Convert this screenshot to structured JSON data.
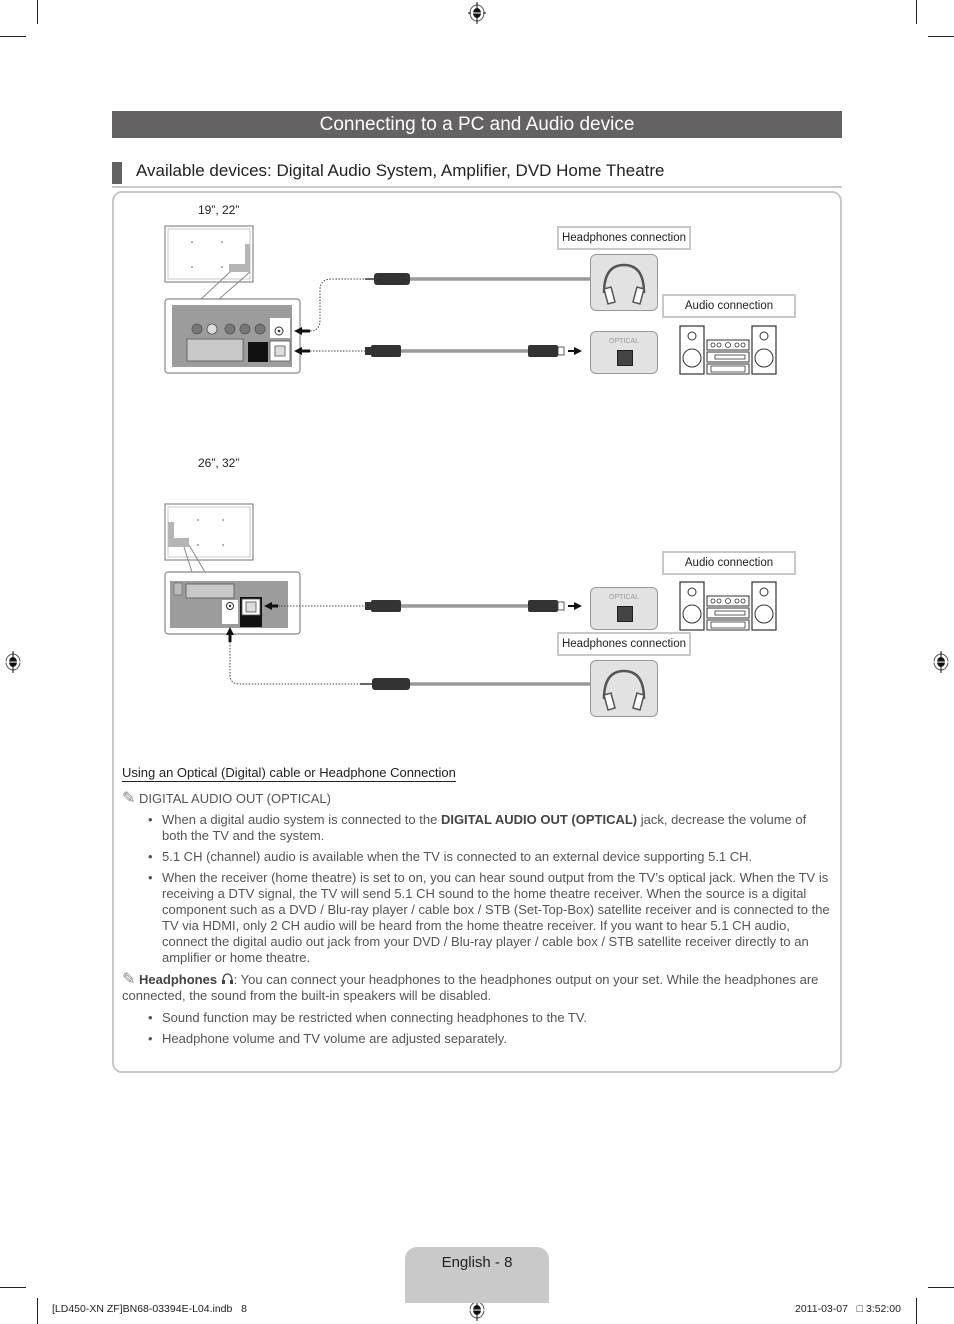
{
  "header": {
    "title": "Connecting to a PC and Audio device",
    "subtitle": "Available devices: Digital Audio System, Amplifier, DVD Home Theatre"
  },
  "diagram": {
    "top": {
      "size_label": "19”, 22”",
      "headphones_label": "Headphones connection",
      "audio_label": "Audio connection",
      "optical_label": "OPTICAL"
    },
    "bottom": {
      "size_label": "26”, 32”",
      "headphones_label": "Headphones connection",
      "audio_label": "Audio connection",
      "optical_label": "OPTICAL"
    }
  },
  "content": {
    "section_title": "Using an Optical (Digital) cable or Headphone Connection",
    "note1": {
      "icon": "pencil-note-icon",
      "heading": "DIGITAL AUDIO OUT (OPTICAL)",
      "bullets": [
        {
          "pre": "When a digital audio system is connected to the ",
          "bold": "DIGITAL AUDIO OUT (OPTICAL)",
          "post": " jack, decrease the volume of both the TV and the system."
        },
        {
          "text": "5.1 CH (channel) audio is available when the TV is connected to an external device supporting 5.1 CH."
        },
        {
          "text": "When the receiver (home theatre) is set to on, you can hear sound output from the TV’s optical jack. When the TV is receiving a DTV signal, the TV will send 5.1 CH sound to the home theatre receiver. When the source is a digital component such as a DVD / Blu-ray player / cable box / STB (Set-Top-Box) satellite receiver and is connected to the TV via HDMI, only 2 CH audio will be heard from the home theatre receiver. If you want to hear 5.1 CH audio, connect the digital audio out jack from your DVD / Blu-ray player / cable box / STB satellite receiver directly to an amplifier or home theatre."
        }
      ]
    },
    "note2": {
      "icon": "pencil-note-icon",
      "bold": "Headphones",
      "inline_icon": "headphones-icon",
      "text": ": You can connect your headphones to the headphones output on your set. While the headphones are connected, the sound from the built-in speakers will be disabled.",
      "bullets": [
        {
          "text": "Sound function may be restricted when connecting headphones to the TV."
        },
        {
          "text": "Headphone volume and TV volume are adjusted separately."
        }
      ]
    }
  },
  "footer": {
    "page_label": "English - 8",
    "file_info": "[LD450-XN ZF]BN68-03394E-L04.indb   8",
    "timestamp": "2011-03-07   □ 3:52:00"
  }
}
